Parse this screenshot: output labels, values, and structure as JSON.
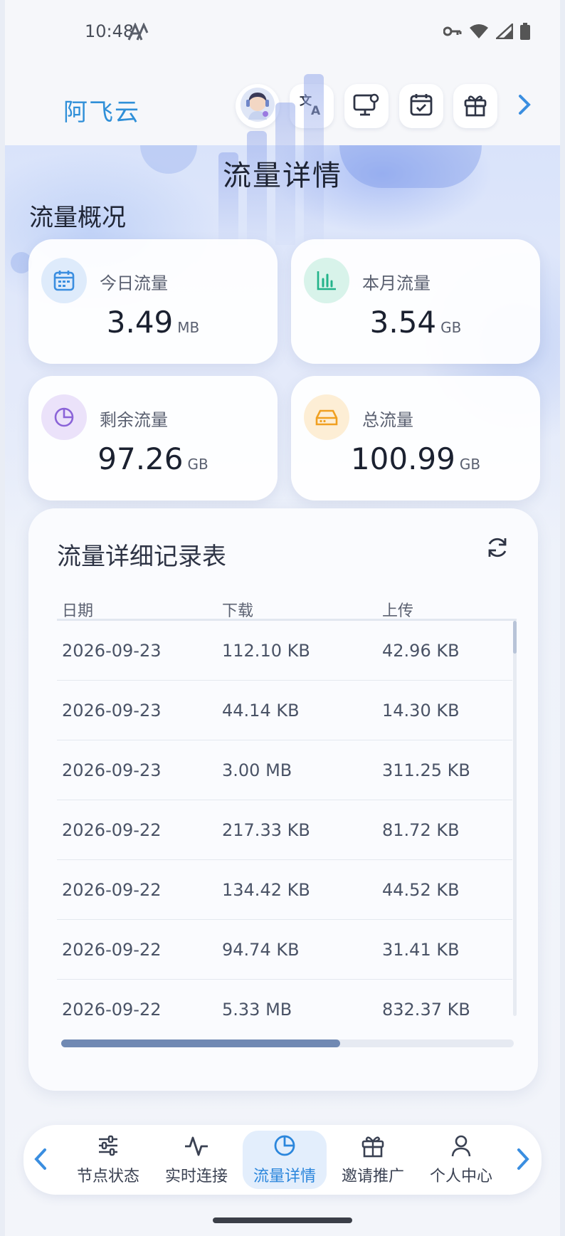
{
  "status_bar": {
    "time": "10:48"
  },
  "header": {
    "brand": "阿飞云"
  },
  "page_title": "流量详情",
  "overview": {
    "title": "流量概况",
    "cards": [
      {
        "label": "今日流量",
        "value": "3.49",
        "unit": "MB",
        "icon": "calendar-icon",
        "color": "#3b8ee0"
      },
      {
        "label": "本月流量",
        "value": "3.54",
        "unit": "GB",
        "icon": "bar-chart-icon",
        "color": "#22b38a"
      },
      {
        "label": "剩余流量",
        "value": "97.26",
        "unit": "GB",
        "icon": "pie-chart-icon",
        "color": "#8a63d8"
      },
      {
        "label": "总流量",
        "value": "100.99",
        "unit": "GB",
        "icon": "hard-drive-icon",
        "color": "#f0a020"
      }
    ]
  },
  "records": {
    "title": "流量详细记录表",
    "columns": [
      "日期",
      "下载",
      "上传"
    ],
    "rows": [
      [
        "2026-09-23",
        "112.10 KB",
        "42.96 KB"
      ],
      [
        "2026-09-23",
        "44.14 KB",
        "14.30 KB"
      ],
      [
        "2026-09-23",
        "3.00 MB",
        "311.25 KB"
      ],
      [
        "2026-09-22",
        "217.33 KB",
        "81.72 KB"
      ],
      [
        "2026-09-22",
        "134.42 KB",
        "44.52 KB"
      ],
      [
        "2026-09-22",
        "94.74 KB",
        "31.41 KB"
      ],
      [
        "2026-09-22",
        "5.33 MB",
        "832.37 KB"
      ]
    ]
  },
  "bottom_nav": {
    "items": [
      {
        "label": "节点状态",
        "icon": "sliders-icon"
      },
      {
        "label": "实时连接",
        "icon": "activity-icon"
      },
      {
        "label": "流量详情",
        "icon": "pie-chart-icon",
        "active": true
      },
      {
        "label": "邀请推广",
        "icon": "gift-icon"
      },
      {
        "label": "个人中心",
        "icon": "user-icon"
      }
    ]
  },
  "colors": {
    "accent": "#2b86dc",
    "brand": "#2f8fd8"
  }
}
